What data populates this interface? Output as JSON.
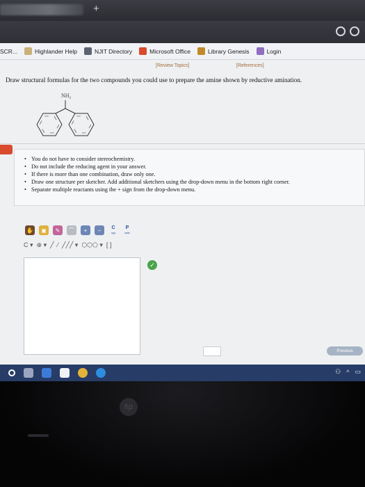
{
  "browser": {
    "new_tab_icon": "plus-icon",
    "bookmarks": [
      {
        "label": "SCR...",
        "color": "#2a6fd6"
      },
      {
        "label": "Highlander Help",
        "color": "#c9b27a"
      },
      {
        "label": "NJIT Directory",
        "color": "#5d6470"
      },
      {
        "label": "Microsoft Office",
        "color": "#d94a2b"
      },
      {
        "label": "Library Genesis",
        "color": "#c08a2a"
      },
      {
        "label": "Login",
        "color": "#8e6fbf"
      }
    ]
  },
  "page": {
    "review_topics": "[Review Topics]",
    "references": "[References]",
    "question": "Draw structural formulas for the two compounds you could use to prepare the amine shown by reductive amination.",
    "molecule_label": "NH",
    "molecule_label_sub": "2",
    "instructions": [
      "You do not have to consider stereochemistry.",
      "Do not include the reducing agent in your answer.",
      "If there is more than one combination, draw only one.",
      "Draw one structure per sketcher. Add additional sketchers using the drop-down menu in the bottom right corner.",
      "Separate multiple reactants using the + sign from the drop-down menu."
    ],
    "toolbar": {
      "copy_letter": "C",
      "copy_label": "opy",
      "paste_letter": "P",
      "paste_label": "aste"
    },
    "previous_label": "Previous",
    "colors": {
      "accent": "#d84b2d",
      "check": "#4aa34a",
      "taskbar": "#273c66"
    }
  }
}
